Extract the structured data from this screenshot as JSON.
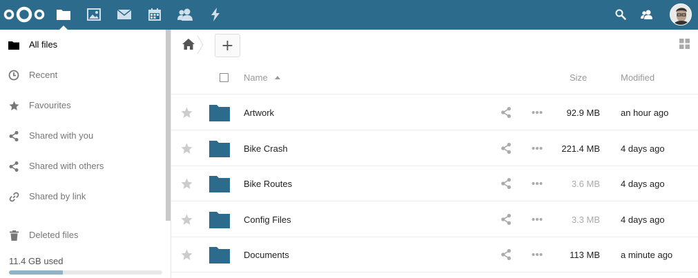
{
  "header": {
    "logo": "nextcloud-logo",
    "apps": [
      {
        "name": "files",
        "icon": "folder-icon",
        "active": true
      },
      {
        "name": "gallery",
        "icon": "image-icon"
      },
      {
        "name": "mail",
        "icon": "mail-icon"
      },
      {
        "name": "calendar",
        "icon": "calendar-icon"
      },
      {
        "name": "contacts",
        "icon": "contacts-icon"
      },
      {
        "name": "activity",
        "icon": "lightning-icon"
      }
    ],
    "right": [
      "search-icon",
      "contacts-menu-icon",
      "avatar"
    ],
    "colors": {
      "bar": "#2c6b8c"
    }
  },
  "sidebar": {
    "items": [
      {
        "label": "All files",
        "icon": "folder-icon",
        "active": true
      },
      {
        "label": "Recent",
        "icon": "clock-icon"
      },
      {
        "label": "Favourites",
        "icon": "star-icon"
      },
      {
        "label": "Shared with you",
        "icon": "share-icon"
      },
      {
        "label": "Shared with others",
        "icon": "share-icon"
      },
      {
        "label": "Shared by link",
        "icon": "link-icon"
      },
      {
        "label": "Deleted files",
        "icon": "trash-icon"
      }
    ],
    "quota": {
      "label": "11.4 GB used",
      "fraction": 0.35
    }
  },
  "toolbar": {
    "new_label": "+"
  },
  "table": {
    "headers": {
      "name": "Name",
      "size": "Size",
      "modified": "Modified"
    },
    "rows": [
      {
        "name": "Artwork",
        "size": "92.9 MB",
        "modified": "an hour ago",
        "size_color": "#222222"
      },
      {
        "name": "Bike Crash",
        "size": "221.4 MB",
        "modified": "4 days ago",
        "size_color": "#222222"
      },
      {
        "name": "Bike Routes",
        "size": "3.6 MB",
        "modified": "4 days ago",
        "size_color": "#aaaaaa"
      },
      {
        "name": "Config Files",
        "size": "3.3 MB",
        "modified": "4 days ago",
        "size_color": "#aaaaaa"
      },
      {
        "name": "Documents",
        "size": "113 MB",
        "modified": "a minute ago",
        "size_color": "#222222"
      }
    ]
  }
}
